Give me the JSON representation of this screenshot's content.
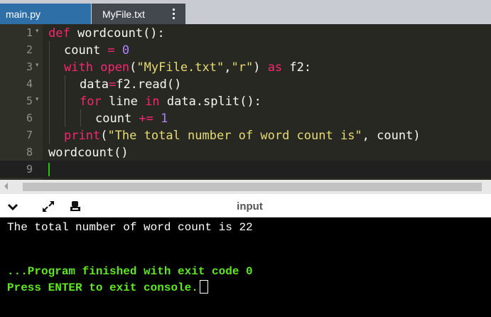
{
  "tabs": [
    {
      "label": "main.py",
      "active": true
    },
    {
      "label": "MyFile.txt",
      "active": false
    }
  ],
  "tab_menu_icon": "vertical-ellipsis-icon",
  "editor": {
    "theme_colors": {
      "background": "#272822",
      "gutter": "#2f3129",
      "keyword": "#f92672",
      "builtin": "#66d9ef",
      "string": "#e6db74",
      "number": "#ae81ff"
    },
    "lines": [
      {
        "n": "1",
        "fold": true
      },
      {
        "n": "2",
        "fold": false
      },
      {
        "n": "3",
        "fold": true
      },
      {
        "n": "4",
        "fold": false
      },
      {
        "n": "5",
        "fold": true
      },
      {
        "n": "6",
        "fold": false
      },
      {
        "n": "7",
        "fold": false
      },
      {
        "n": "8",
        "fold": false
      },
      {
        "n": "9",
        "fold": false
      }
    ],
    "tokens": {
      "l1": [
        "def",
        " wordcount():"
      ],
      "l2": [
        "count",
        " = ",
        "0"
      ],
      "l3": [
        "with",
        " ",
        "open",
        "(",
        "\"MyFile.txt\"",
        ",",
        "\"r\"",
        ") ",
        "as",
        " f2:"
      ],
      "l4": [
        "data",
        "=",
        "f2.read()"
      ],
      "l5": [
        "for",
        " line ",
        "in",
        " data.split():"
      ],
      "l6": [
        "count",
        " += ",
        "1"
      ],
      "l7": [
        "print",
        "(",
        "\"The total number of word count is\"",
        ", count)"
      ],
      "l8": [
        "wordcount()"
      ]
    },
    "fold_marker": "▾"
  },
  "console_toolbar": {
    "title": "input",
    "icons": [
      "chevron-down-icon",
      "expand-icon",
      "stop-icon"
    ]
  },
  "console": {
    "output": "The total number of word count is 22",
    "finished": "...Program finished with exit code 0",
    "prompt": "Press ENTER to exit console."
  }
}
